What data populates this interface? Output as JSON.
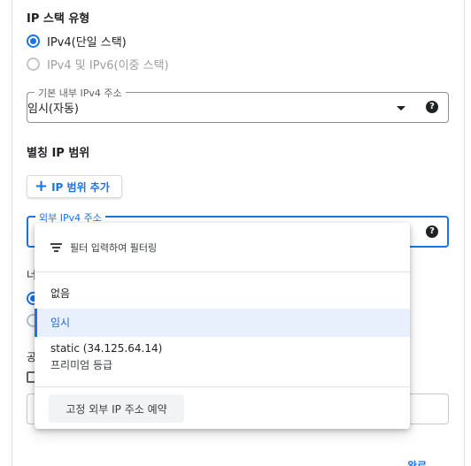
{
  "ip_stack": {
    "title": "IP 스택 유형",
    "options": [
      {
        "label": "IPv4(단일 스택)",
        "selected": true,
        "disabled": false
      },
      {
        "label": "IPv4 및 IPv6(이중 스택)",
        "selected": false,
        "disabled": true
      }
    ]
  },
  "internal_ip": {
    "legend": "기본 내부 IPv4 주소",
    "value": "임시(자동)",
    "help_icon": "help-icon"
  },
  "alias_ranges": {
    "title": "별칭 IP 범위",
    "add_button_label": "IP 범위 추가",
    "add_icon": "plus-icon"
  },
  "external_ip": {
    "legend": "외부 IPv4 주소",
    "help_icon": "help-icon",
    "dropdown": {
      "filter_placeholder": "필터 입력하여 필터링",
      "filter_icon": "filter-icon",
      "options": [
        {
          "label": "없음",
          "sublabel": "",
          "selected": false
        },
        {
          "label": "임시",
          "sublabel": "",
          "selected": true
        },
        {
          "label": "static (34.125.64.14)",
          "sublabel": "프리미엄 등급",
          "selected": false
        }
      ],
      "reserve_button_label": "고정 외부 IP 주소 예약"
    }
  },
  "partial_labels": {
    "network_tier": "너",
    "public": "공"
  },
  "bottom_link": "완료",
  "colors": {
    "accent": "#1a73e8",
    "selected_bg": "#e8f0fe",
    "text": "#202124"
  }
}
